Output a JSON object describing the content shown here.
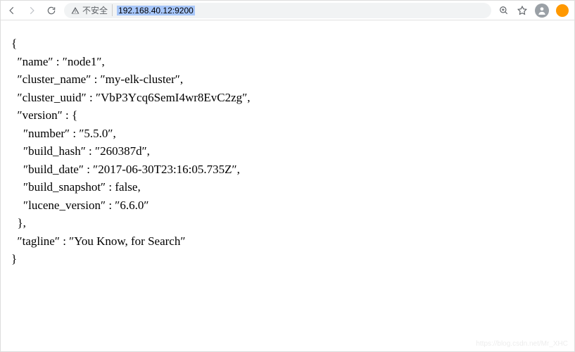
{
  "toolbar": {
    "security_label": "不安全",
    "url": "192.168.40.12:9200"
  },
  "response": {
    "name": "node1",
    "cluster_name": "my-elk-cluster",
    "cluster_uuid": "VbP3Ycq6SemI4wr8EvC2zg",
    "version": {
      "number": "5.5.0",
      "build_hash": "260387d",
      "build_date": "2017-06-30T23:16:05.735Z",
      "build_snapshot": "false",
      "lucene_version": "6.6.0"
    },
    "tagline": "You Know, for Search"
  },
  "labels": {
    "name": "name",
    "cluster_name": "cluster_name",
    "cluster_uuid": "cluster_uuid",
    "version": "version",
    "number": "number",
    "build_hash": "build_hash",
    "build_date": "build_date",
    "build_snapshot": "build_snapshot",
    "lucene_version": "lucene_version",
    "tagline": "tagline"
  },
  "watermark": "https://blog.csdn.net/Mr_XHC"
}
